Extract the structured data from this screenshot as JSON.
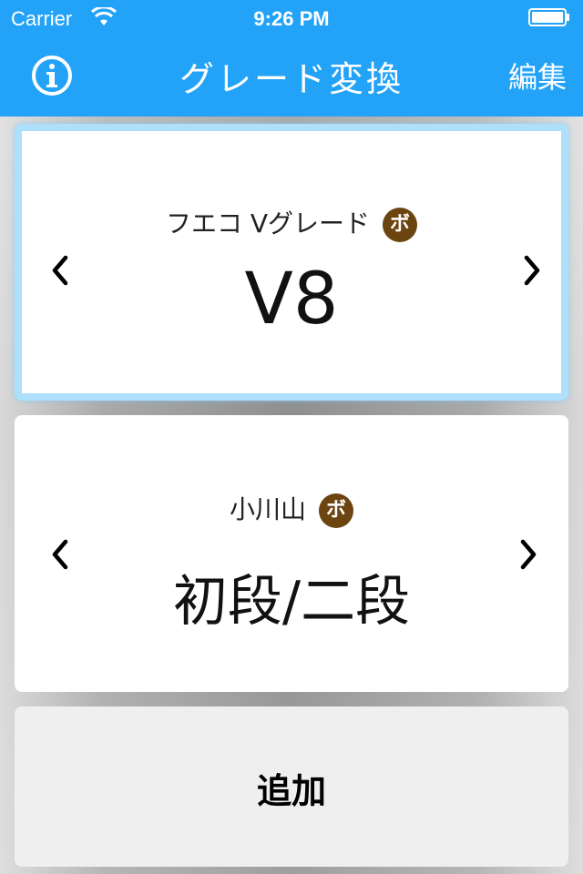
{
  "status_bar": {
    "carrier": "Carrier",
    "time": "9:26 PM"
  },
  "nav": {
    "title": "グレード変換",
    "edit_label": "編集",
    "info_icon": "info-circle-icon",
    "accent_color": "#23a3f7"
  },
  "converters": [
    {
      "system_name": "フエコ Vグレード",
      "badge": "ボ",
      "grade": "V8",
      "selected": true
    },
    {
      "system_name": "小川山",
      "badge": "ボ",
      "grade": "初段/二段",
      "selected": false
    }
  ],
  "add_button": {
    "label": "追加"
  },
  "colors": {
    "badge": "#6b4410",
    "selected_border": "#aee0fb"
  }
}
